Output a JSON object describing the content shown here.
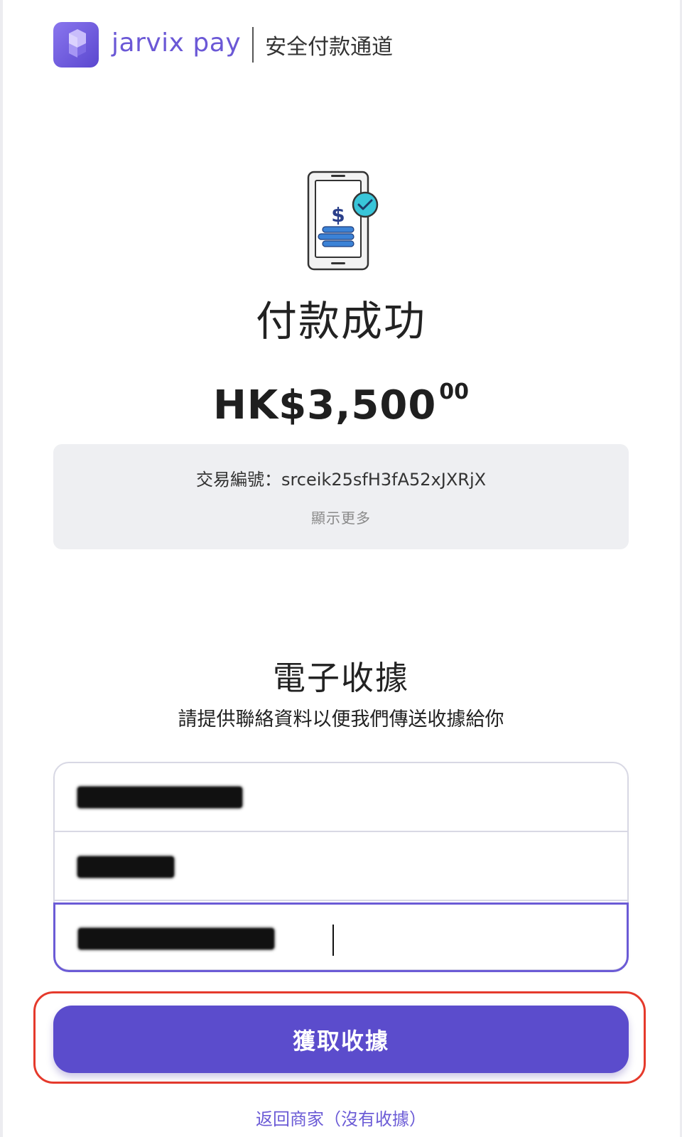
{
  "header": {
    "brand": "jarvix pay",
    "secure_channel": "安全付款通道",
    "brand_color": "#6b58d6"
  },
  "illustration": {
    "icon": "phone-payment-success-icon",
    "symbol": "$"
  },
  "status": {
    "title": "付款成功"
  },
  "amount": {
    "main": "HK$3,500",
    "cents": "00"
  },
  "transaction": {
    "label": "交易編號：",
    "id": "srceik25sfH3fA52xJXRjX",
    "show_more": "顯示更多"
  },
  "receipt": {
    "title": "電子收據",
    "subtitle": "請提供聯絡資料以便我們傳送收據給你",
    "fields": [
      {
        "name": "field-1",
        "value": "",
        "redacted": true
      },
      {
        "name": "field-2",
        "value": "",
        "redacted": true
      },
      {
        "name": "field-3",
        "value": "",
        "redacted": true,
        "focused": true
      }
    ],
    "submit_label": "獲取收據",
    "submit_color": "#5b4ccc"
  },
  "footer": {
    "back_link": "返回商家（沒有收據）"
  }
}
